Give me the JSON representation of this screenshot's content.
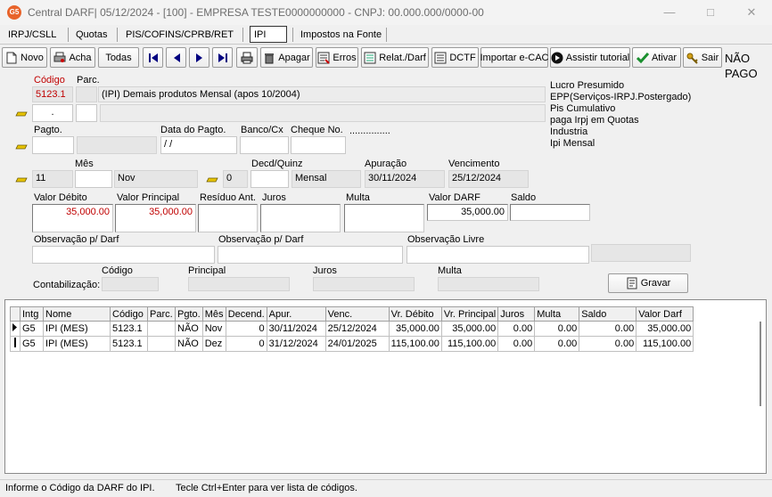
{
  "window": {
    "title": "Central DARF|  05/12/2024 - [100] - EMPRESA TESTE0000000000 - CNPJ: 00.000.000/0000-00",
    "app_badge": "G5",
    "minimize": "—",
    "maximize": "□",
    "close": "✕"
  },
  "tabs": [
    {
      "label": "IRPJ/CSLL"
    },
    {
      "label": "Quotas"
    },
    {
      "label": "PIS/COFINS/CPRB/RET"
    },
    {
      "label": "IPI"
    },
    {
      "label": "Impostos na Fonte"
    }
  ],
  "toolbar": {
    "novo": "Novo",
    "acha": "Acha",
    "todas": "Todas",
    "apagar": "Apagar",
    "erros": "Erros",
    "relat": "Relat./Darf",
    "dctf": "DCTF",
    "importar": "Importar e-CAC",
    "tutorial": "Assistir tutorial",
    "ativar": "Ativar",
    "sair": "Sair",
    "status_l1": "NÃO",
    "status_l2": "PAGO"
  },
  "regime": [
    "Lucro Presumido",
    "EPP(Serviços-IRPJ.Postergado)",
    "Pis Cumulativo",
    "paga Irpj em Quotas",
    "Industria",
    "Ipi Mensal"
  ],
  "form": {
    "codigo_label": "Código",
    "codigo": "5123.1",
    "parc_label": "Parc.",
    "parc": "",
    "descricao": "(IPI) Demais produtos Mensal (apos 10/2004)",
    "sub_value": ".",
    "pagto_label": "Pagto.",
    "pagto": "",
    "data_pagto_label": "Data do Pagto.",
    "data_pagto": " /  /",
    "banco_label": "Banco/Cx",
    "banco": "",
    "cheque_label": "Cheque No.",
    "cheque": "",
    "cheque_dots": "...............",
    "mes_label": "Mês",
    "mes_num": "11",
    "mes": "",
    "mes_name": "Nov",
    "decd_label": "Decd/Quinz",
    "decd": "0",
    "decd_val": "",
    "periodo": "Mensal",
    "apuracao_label": "Apuração",
    "apuracao": "30/11/2024",
    "vencimento_label": "Vencimento",
    "vencimento": "25/12/2024",
    "valor_debito_label": "Valor Débito",
    "valor_debito": "35,000.00",
    "valor_principal_label": "Valor Principal",
    "valor_principal": "35,000.00",
    "residuo_label": "Resíduo Ant.",
    "residuo": "",
    "juros_label": "Juros",
    "juros": "",
    "multa_label": "Multa",
    "multa": "",
    "valor_darf_label": "Valor DARF",
    "valor_darf": "35,000.00",
    "saldo_label": "Saldo",
    "saldo": "",
    "obs1_label": "Observação p/ Darf",
    "obs1": "",
    "obs2_label": "Observação p/ Darf",
    "obs2": "",
    "obs3_label": "Observação Livre",
    "obs3": "",
    "contab_label": "Contabilização:",
    "contab_codigo_label": "Código",
    "contab_principal_label": "Principal",
    "contab_juros_label": "Juros",
    "contab_multa_label": "Multa",
    "gravar": "Gravar"
  },
  "table": {
    "columns": [
      "Intg",
      "Nome",
      "Código",
      "Parc.",
      "Pgto.",
      "Mês",
      "Decend.",
      "Apur.",
      "Venc.",
      "Vr. Débito",
      "Vr. Principal",
      "Juros",
      "Multa",
      "Saldo",
      "Valor Darf"
    ],
    "rows": [
      [
        "G5",
        "IPI (MES)",
        "5123.1",
        "",
        "NÃO",
        "Nov",
        "0",
        "30/11/2024",
        "25/12/2024",
        "35,000.00",
        "35,000.00",
        "0.00",
        "0.00",
        "0.00",
        "35,000.00"
      ],
      [
        "G5",
        "IPI (MES)",
        "5123.1",
        "",
        "NÃO",
        "Dez",
        "0",
        "31/12/2024",
        "24/01/2025",
        "115,100.00",
        "115,100.00",
        "0.00",
        "0.00",
        "0.00",
        "115,100.00"
      ]
    ]
  },
  "status": {
    "hint1": "Informe o Código da DARF do IPI.",
    "hint2": "Tecle Ctrl+Enter para ver lista de códigos."
  }
}
